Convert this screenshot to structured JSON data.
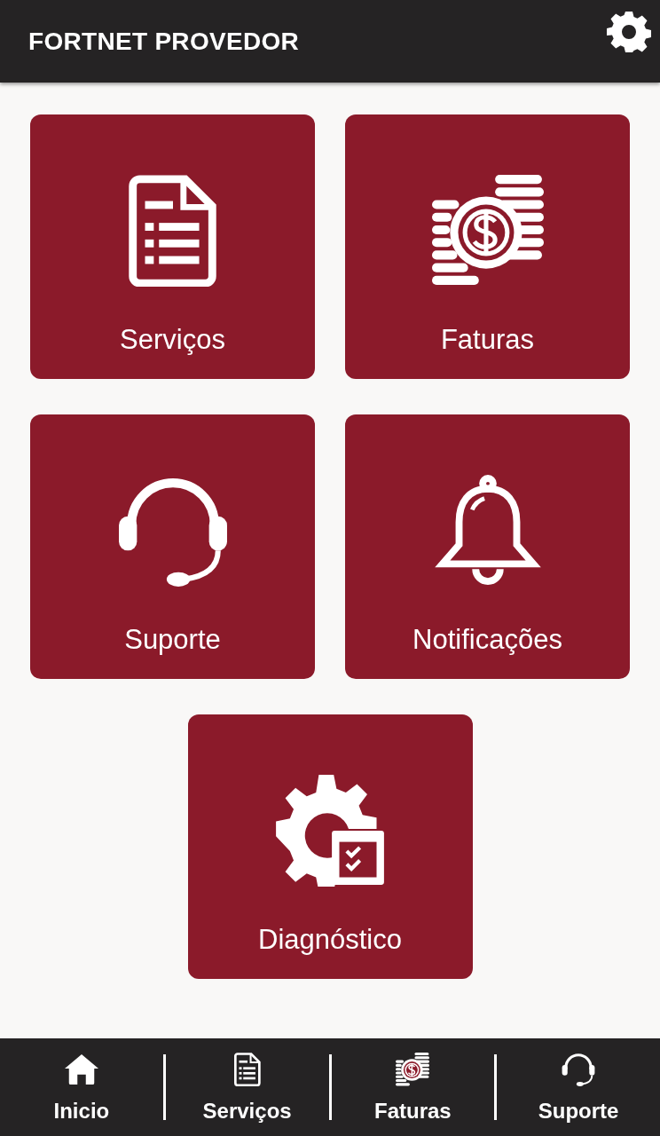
{
  "header": {
    "title": "FORTNET PROVEDOR"
  },
  "tiles": [
    {
      "kind": "document",
      "label": "Serviços"
    },
    {
      "kind": "coins",
      "label": "Faturas"
    },
    {
      "kind": "headset",
      "label": "Suporte"
    },
    {
      "kind": "bell",
      "label": "Notificações"
    },
    {
      "kind": "gear-check",
      "label": "Diagnóstico"
    }
  ],
  "bottom_nav": [
    {
      "kind": "home",
      "label": "Inicio"
    },
    {
      "kind": "document",
      "label": "Serviços"
    },
    {
      "kind": "coins",
      "label": "Faturas"
    },
    {
      "kind": "headset",
      "label": "Suporte"
    }
  ]
}
